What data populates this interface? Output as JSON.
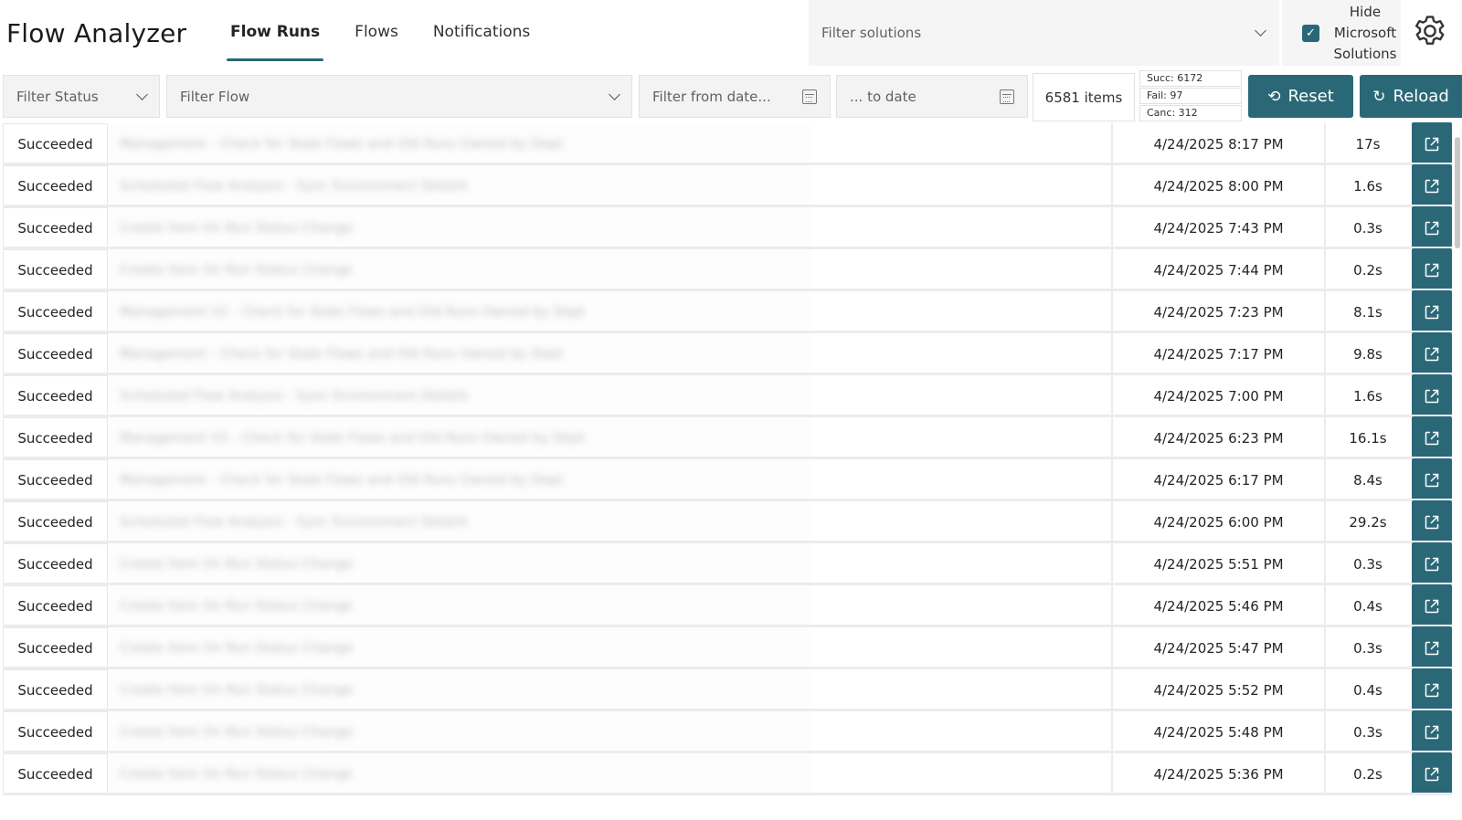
{
  "app": {
    "title": "Flow Analyzer"
  },
  "nav": {
    "tabs": [
      {
        "label": "Flow Runs",
        "active": true
      },
      {
        "label": "Flows",
        "active": false
      },
      {
        "label": "Notifications",
        "active": false
      }
    ]
  },
  "solutions_filter": {
    "placeholder": "Filter solutions",
    "icon": "chevron-down-icon"
  },
  "hide_microsoft": {
    "label": "Hide Microsoft Solutions",
    "checked": true
  },
  "settings": {
    "icon": "gear-icon"
  },
  "filters": {
    "status_placeholder": "Filter Status",
    "flow_placeholder": "Filter Flow",
    "from_date_placeholder": "Filter from date...",
    "to_date_placeholder": "... to date"
  },
  "summary": {
    "items": "6581 items",
    "succeeded": "Succ: 6172",
    "failed": "Fail: 97",
    "cancelled": "Canc: 312"
  },
  "buttons": {
    "reset": "Reset",
    "reload": "Reload"
  },
  "colors": {
    "accent": "#2a6878"
  },
  "runs": [
    {
      "status": "Succeeded",
      "flow": "Management - Check for Stale Flows and Old Runs Owned by Dept",
      "date": "4/24/2025 8:17 PM",
      "duration": "17s"
    },
    {
      "status": "Succeeded",
      "flow": "Scheduled Flow Analysis - Sync Environment Details",
      "date": "4/24/2025 8:00 PM",
      "duration": "1.6s"
    },
    {
      "status": "Succeeded",
      "flow": "Create Item On Run Status Change",
      "date": "4/24/2025 7:43 PM",
      "duration": "0.3s"
    },
    {
      "status": "Succeeded",
      "flow": "Create Item On Run Status Change",
      "date": "4/24/2025 7:44 PM",
      "duration": "0.2s"
    },
    {
      "status": "Succeeded",
      "flow": "Management V2 - Check for Stale Flows and Old Runs Owned by Dept",
      "date": "4/24/2025 7:23 PM",
      "duration": "8.1s"
    },
    {
      "status": "Succeeded",
      "flow": "Management - Check for Stale Flows and Old Runs Owned by Dept",
      "date": "4/24/2025 7:17 PM",
      "duration": "9.8s"
    },
    {
      "status": "Succeeded",
      "flow": "Scheduled Flow Analysis - Sync Environment Details",
      "date": "4/24/2025 7:00 PM",
      "duration": "1.6s"
    },
    {
      "status": "Succeeded",
      "flow": "Management V2 - Check for Stale Flows and Old Runs Owned by Dept",
      "date": "4/24/2025 6:23 PM",
      "duration": "16.1s"
    },
    {
      "status": "Succeeded",
      "flow": "Management - Check for Stale Flows and Old Runs Owned by Dept",
      "date": "4/24/2025 6:17 PM",
      "duration": "8.4s"
    },
    {
      "status": "Succeeded",
      "flow": "Scheduled Flow Analysis - Sync Environment Details",
      "date": "4/24/2025 6:00 PM",
      "duration": "29.2s"
    },
    {
      "status": "Succeeded",
      "flow": "Create Item On Run Status Change",
      "date": "4/24/2025 5:51 PM",
      "duration": "0.3s"
    },
    {
      "status": "Succeeded",
      "flow": "Create Item On Run Status Change",
      "date": "4/24/2025 5:46 PM",
      "duration": "0.4s"
    },
    {
      "status": "Succeeded",
      "flow": "Create Item On Run Status Change",
      "date": "4/24/2025 5:47 PM",
      "duration": "0.3s"
    },
    {
      "status": "Succeeded",
      "flow": "Create Item On Run Status Change",
      "date": "4/24/2025 5:52 PM",
      "duration": "0.4s"
    },
    {
      "status": "Succeeded",
      "flow": "Create Item On Run Status Change",
      "date": "4/24/2025 5:48 PM",
      "duration": "0.3s"
    },
    {
      "status": "Succeeded",
      "flow": "Create Item On Run Status Change",
      "date": "4/24/2025 5:36 PM",
      "duration": "0.2s"
    }
  ]
}
